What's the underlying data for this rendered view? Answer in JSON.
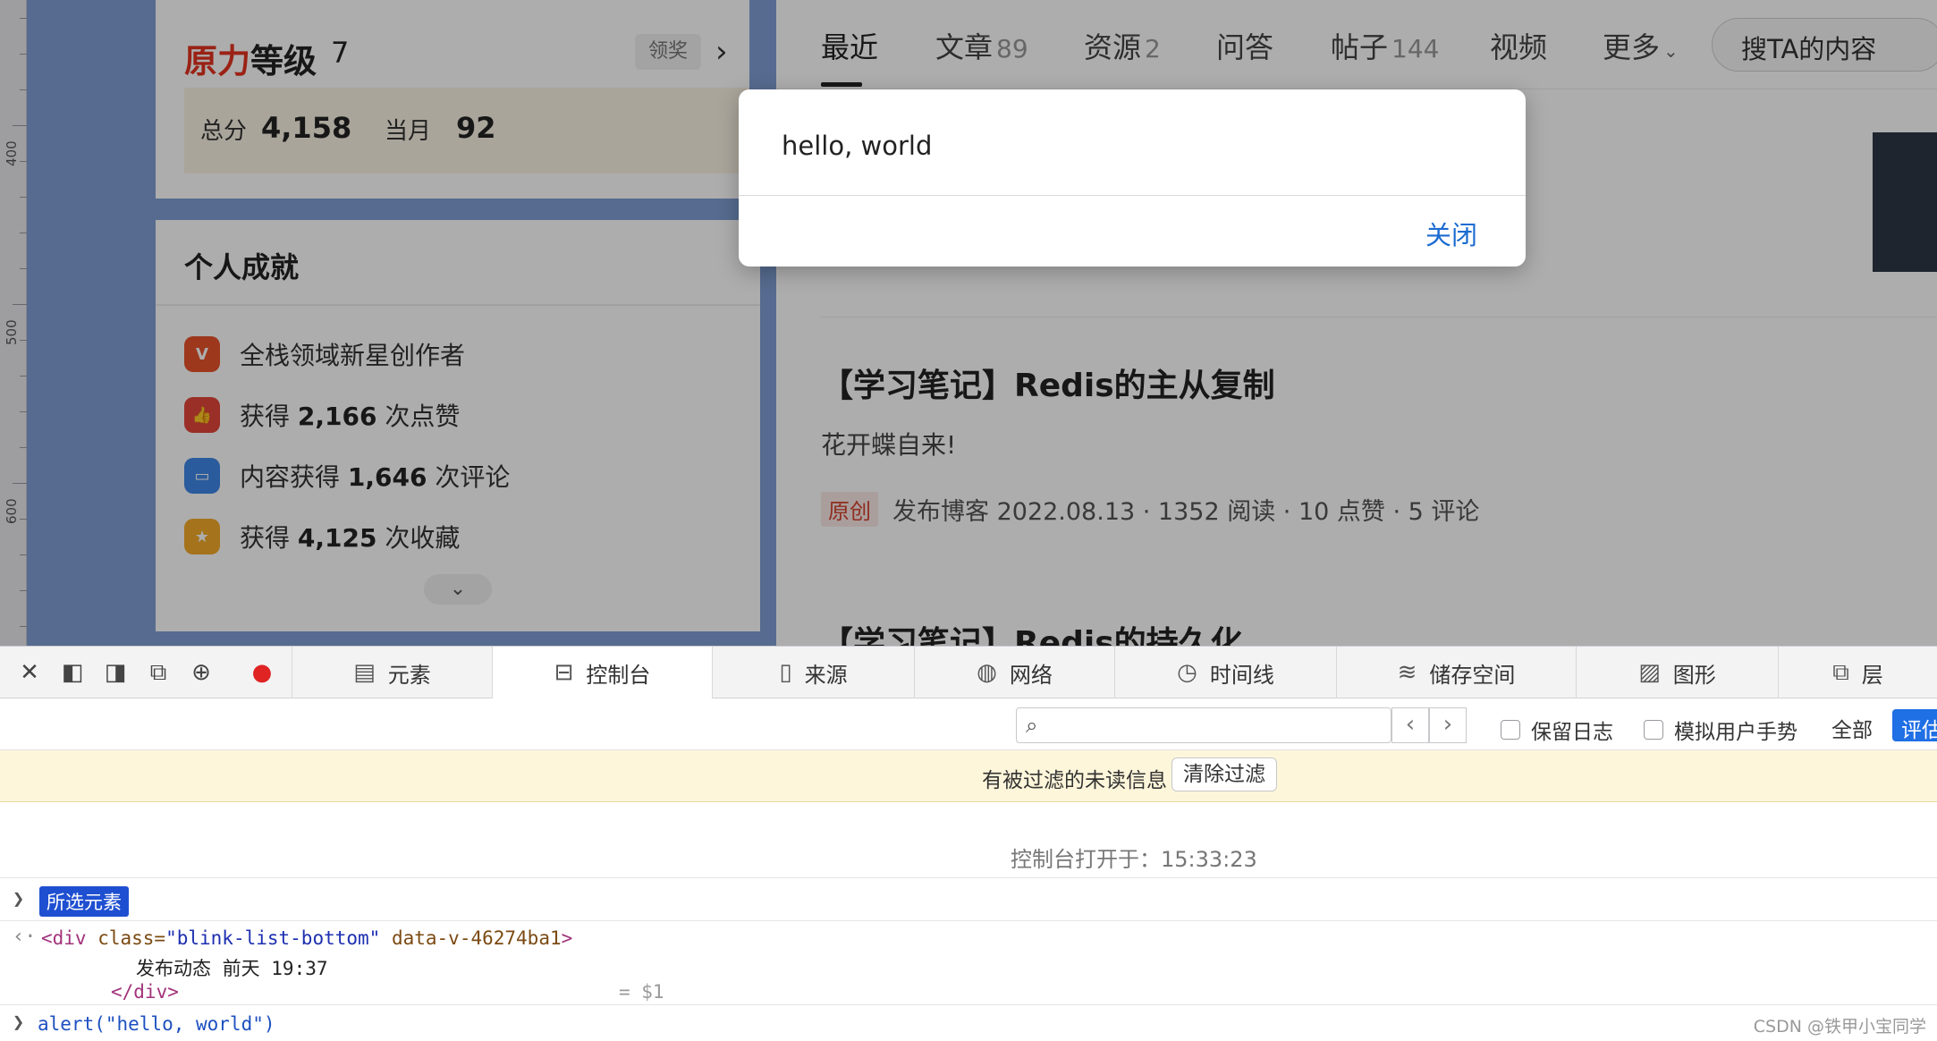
{
  "ruler": {
    "labels": [
      "400",
      "500",
      "600"
    ]
  },
  "level_card": {
    "title_red": "原力",
    "title_rest": "等级",
    "level": "7",
    "award_label": "领奖",
    "total_label": "总分",
    "total_value": "4,158",
    "month_label": "当月",
    "month_value": "92"
  },
  "achievements": {
    "title": "个人成就",
    "items": [
      {
        "pre": "全栈领域新星创作者",
        "num": "",
        "post": "",
        "icon": "v-badge-icon",
        "color": "#e8532c"
      },
      {
        "pre": "获得 ",
        "num": "2,166",
        "post": " 次点赞",
        "icon": "thumbs-up-badge-icon",
        "color": "#e2463a"
      },
      {
        "pre": "内容获得 ",
        "num": "1,646",
        "post": " 次评论",
        "icon": "comment-badge-icon",
        "color": "#3f86e6"
      },
      {
        "pre": "获得 ",
        "num": "4,125",
        "post": " 次收藏",
        "icon": "star-badge-icon",
        "color": "#f3aa2a"
      }
    ]
  },
  "tabs": [
    {
      "label": "最近",
      "count": ""
    },
    {
      "label": "文章",
      "count": "89"
    },
    {
      "label": "资源",
      "count": "2"
    },
    {
      "label": "问答",
      "count": ""
    },
    {
      "label": "帖子",
      "count": "144"
    },
    {
      "label": "视频",
      "count": ""
    },
    {
      "label": "更多",
      "count": ""
    }
  ],
  "search_placeholder": "搜TA的内容",
  "articles": [
    {
      "title": "【学习笔记】Redis的主从复制",
      "subtitle": "花开蝶自来!",
      "tag": "原创",
      "meta": "发布博客 2022.08.13 · 1352 阅读 · 10 点赞 · 5 评论"
    },
    {
      "title": "【学习笔记】Redis的持久化"
    }
  ],
  "alert": {
    "message": "hello, world",
    "close_label": "关闭"
  },
  "devtools": {
    "tabs": [
      {
        "label": "元素",
        "icon": "elements-icon"
      },
      {
        "label": "控制台",
        "icon": "console-icon"
      },
      {
        "label": "来源",
        "icon": "sources-icon"
      },
      {
        "label": "网络",
        "icon": "network-icon"
      },
      {
        "label": "时间线",
        "icon": "timeline-icon"
      },
      {
        "label": "储存空间",
        "icon": "storage-icon"
      },
      {
        "label": "图形",
        "icon": "graphics-icon"
      },
      {
        "label": "层",
        "icon": "layers-icon"
      }
    ],
    "active_tab": "控制台",
    "preserve_log": "保留日志",
    "emulate_gesture": "模拟用户手势",
    "all_label": "全部",
    "eval_label": "评估",
    "notice_text": "有被过滤的未读信息",
    "clear_filter": "清除过滤",
    "console_opened": "控制台打开于：15:33:23",
    "selected_badge": "所选元素",
    "code": {
      "open_tag": "<div",
      "attr1": " class=",
      "val1": "\"blink-list-bottom\"",
      "attr2": " data-v-46274ba1",
      "close_bracket": ">",
      "text": "发布动态 前天 19:37",
      "end_tag": "</div>",
      "ref": "= $1",
      "input": "alert(\"hello, world\")"
    },
    "accent": "#1f6fe5"
  },
  "watermark": "CSDN @铁甲小宝同学"
}
